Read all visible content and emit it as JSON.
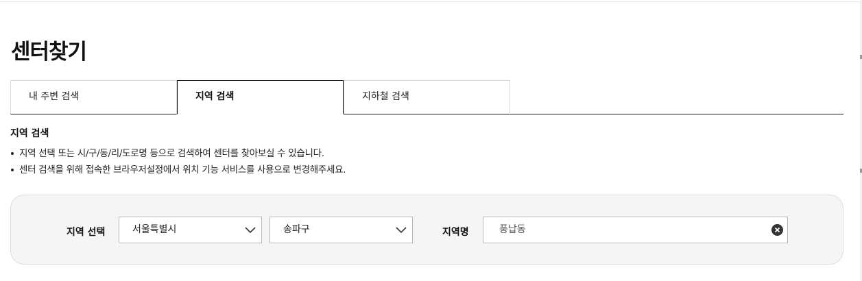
{
  "page": {
    "title": "센터찾기"
  },
  "tabs": [
    {
      "label": "내 주변 검색",
      "active": false
    },
    {
      "label": "지역 검색",
      "active": true
    },
    {
      "label": "지하철 검색",
      "active": false
    }
  ],
  "section": {
    "heading": "지역 검색",
    "notes": [
      "지역 선택 또는 시/구/동/리/도로명 등으로 검색하여 센터를 찾아보실 수 있습니다.",
      "센터 검색을 위해 접속한 브라우저설정에서 위치 기능 서비스를 사용으로 변경해주세요."
    ]
  },
  "search": {
    "region_label": "지역 선택",
    "city_value": "서울특별시",
    "district_value": "송파구",
    "name_label": "지역명",
    "name_value": "풍납동"
  },
  "icons": {
    "select_arrow": "chevron-down-icon",
    "clear": "clear-circle-x-icon"
  },
  "colors": {
    "panel_bg": "#f5f5f5",
    "active_tab_border": "#111111"
  }
}
